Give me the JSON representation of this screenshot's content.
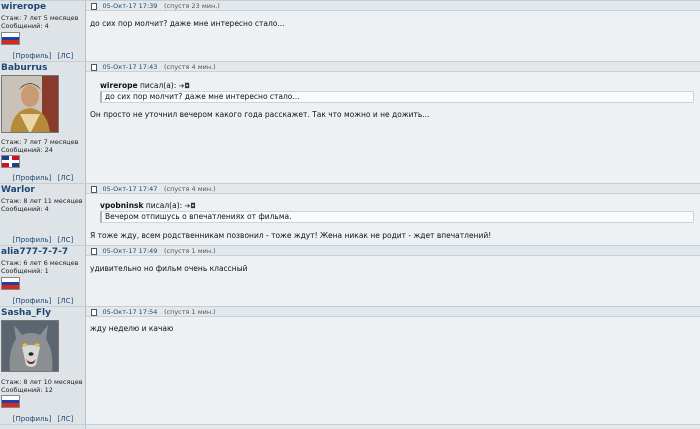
{
  "posts": [
    {
      "author": "wirerope",
      "tenure": "Стаж: 7 лет 5 месяцев",
      "messages": "Сообщений: 4",
      "flag": "russia-flag",
      "profile": "[Профиль]",
      "pm": "[ЛС]",
      "date": "05-Окт-17 17:39",
      "ago": "(спустя 23 мин.)",
      "text": "до сих пор молчит? даже мне интересно стало..."
    },
    {
      "author": "Baburrus",
      "tenure": "Стаж: 7 лет 7 месяцев",
      "messages": "Сообщений: 24",
      "flag": "dominican-republic-flag",
      "profile": "[Профиль]",
      "pm": "[ЛС]",
      "date": "05-Окт-17 17:43",
      "ago": "(спустя 4 мин.)",
      "quote_author": "wirerope",
      "quote_wrote": "писал(а):",
      "quote_text": "до сих пор молчит? даже мне интересно стало...",
      "text": "Он просто не уточнил вечером какого года расскажет. Так что можно и не дожить..."
    },
    {
      "author": "Warlor",
      "tenure": "Стаж: 8 лет 11 месяцев",
      "messages": "Сообщений: 4",
      "profile": "[Профиль]",
      "pm": "[ЛС]",
      "date": "05-Окт-17 17:47",
      "ago": "(спустя 4 мин.)",
      "quote_author": "vpobninsk",
      "quote_wrote": "писал(а):",
      "quote_text": "Вечером отпишусь о впечатлениях от фильма.",
      "text": "Я тоже жду, всем родственникам позвонил - тоже ждут! Жена никак не родит - ждет впечатлений!"
    },
    {
      "author": "alia777-7-7-7",
      "tenure": "Стаж: 6 лет 6 месяцев",
      "messages": "Сообщений: 1",
      "flag": "russia-flag",
      "profile": "[Профиль]",
      "pm": "[ЛС]",
      "date": "05-Окт-17 17:49",
      "ago": "(спустя 1 мин.)",
      "text": "удивительно но фильм очень классный"
    },
    {
      "author": "Sasha_Fly",
      "tenure": "Стаж: 8 лет 10 месяцев",
      "messages": "Сообщений: 12",
      "flag": "russia-flag",
      "profile": "[Профиль]",
      "pm": "[ЛС]",
      "date": "05-Окт-17 17:54",
      "ago": "(спустя 1 мин.)",
      "text": "жду неделю и качаю"
    }
  ]
}
